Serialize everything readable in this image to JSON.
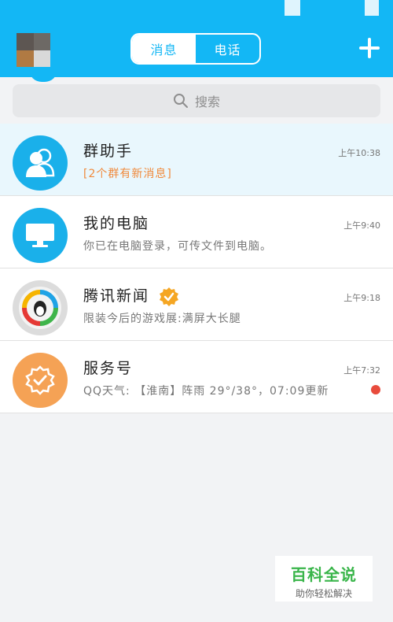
{
  "header": {
    "tabs": [
      {
        "label": "消息",
        "active": true
      },
      {
        "label": "电话",
        "active": false
      }
    ]
  },
  "search": {
    "placeholder": "搜索"
  },
  "conversations": [
    {
      "name": "群助手",
      "preview": "[2个群有新消息]",
      "time": "上午10:38",
      "icon": "group-icon"
    },
    {
      "name": "我的电脑",
      "preview": "你已在电脑登录，可传文件到电脑。",
      "time": "上午9:40",
      "icon": "computer-icon"
    },
    {
      "name": "腾讯新闻",
      "preview": "限装今后的游戏展:满屏大长腿",
      "time": "上午9:18",
      "icon": "tencent-news-icon",
      "verified": true
    },
    {
      "name": "服务号",
      "preview": "QQ天气: 【淮南】阵雨 29°/38°，07:09更新",
      "time": "上午7:32",
      "icon": "service-badge-icon",
      "unread_dot": true
    }
  ],
  "watermark": {
    "title": "百科全说",
    "subtitle": "助你轻松解决"
  },
  "colors": {
    "accent": "#13b7f5",
    "orange": "#f5a255",
    "unread": "#e84b3c"
  }
}
